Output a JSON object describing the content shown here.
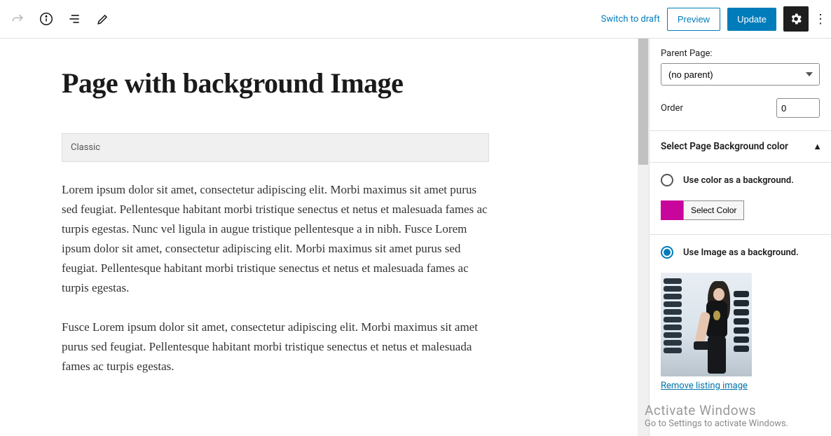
{
  "toolbar": {
    "switch_draft": "Switch to draft",
    "preview": "Preview",
    "update": "Update"
  },
  "editor": {
    "title": "Page with background Image",
    "classic_label": "Classic",
    "para1": "Lorem ipsum dolor sit amet, consectetur adipiscing elit. Morbi maximus sit amet purus sed feugiat. Pellentesque habitant morbi tristique senectus et netus et malesuada fames ac turpis egestas. Nunc vel ligula in augue tristique pellentesque a in nibh. Fusce Lorem ipsum dolor sit amet, consectetur adipiscing elit. Morbi maximus sit amet purus sed feugiat. Pellentesque habitant morbi tristique senectus et netus et malesuada fames ac turpis egestas.",
    "para2": "Fusce Lorem ipsum dolor sit amet, consectetur adipiscing elit. Morbi maximus sit amet purus sed feugiat. Pellentesque habitant morbi tristique senectus et netus et malesuada fames ac turpis egestas."
  },
  "sidebar": {
    "parent_label": "Parent Page:",
    "parent_value": "(no parent)",
    "order_label": "Order",
    "order_value": "0",
    "bg_panel_title": "Select Page Background color",
    "use_color_label": "Use color as a background.",
    "select_color_btn": "Select Color",
    "color_hex": "#c9069b",
    "use_image_label": "Use Image as a background.",
    "remove_link": "Remove listing image"
  },
  "watermark": {
    "line1": "Activate Windows",
    "line2": "Go to Settings to activate Windows."
  }
}
